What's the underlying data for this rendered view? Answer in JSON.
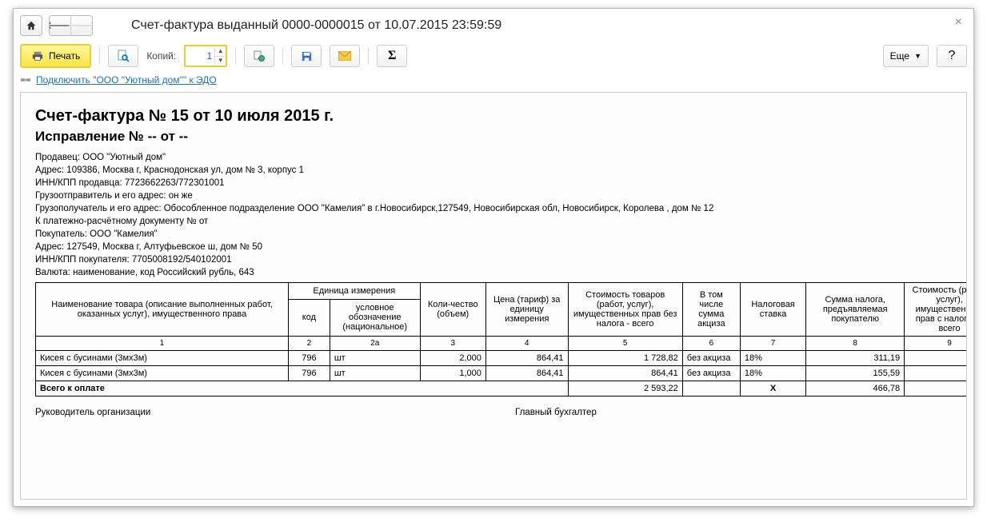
{
  "window": {
    "title": "Счет-фактура выданный 0000-0000015 от 10.07.2015 23:59:59"
  },
  "toolbar": {
    "print_label": "Печать",
    "copies_label": "Копий:",
    "copies_value": "1",
    "more_label": "Еще",
    "help_label": "?"
  },
  "edo_link": "Подключить \"ООО \"Уютный дом\"\" к ЭДО",
  "document": {
    "title": "Счет-фактура № 15 от 10 июля 2015 г.",
    "correction": "Исправление № -- от --",
    "seller": "Продавец: ООО \"Уютный дом\"",
    "seller_address": "Адрес: 109386, Москва г, Краснодонская ул, дом № 3, корпус 1",
    "seller_inn": "ИНН/КПП продавца: 7723662263/772301001",
    "shipper": "Грузоотправитель и его адрес: он же",
    "consignee": "Грузополучатель и его адрес: Обособленное подразделение ООО \"Камелия\" в г.Новосибирск,127549, Новосибирская обл, Новосибирск, Королева , дом № 12",
    "payment_doc": "К платежно-расчётному документу №     от",
    "buyer": "Покупатель: ООО \"Камелия\"",
    "buyer_address": "Адрес: 127549, Москва г, Алтуфьевское ш, дом № 50",
    "buyer_inn": "ИНН/КПП покупателя: 7705008192/540102001",
    "currency": "Валюта: наименование, код Российский рубль, 643",
    "total_label": "Всего к оплате",
    "sign_left": "Руководитель организации",
    "sign_right": "Главный бухгалтер"
  },
  "table": {
    "headers": {
      "name": "Наименование товара (описание выполненных работ, оказанных услуг), имущественного права",
      "unit_group": "Единица измерения",
      "unit_code": "код",
      "unit_name": "условное обозначение (национальное)",
      "qty": "Коли-чество (объем)",
      "price": "Цена (тариф) за единицу измерения",
      "cost_no_tax": "Стоимость товаров (работ, услуг), имущественных прав без налога - всего",
      "excise": "В том числе сумма акциза",
      "tax_rate": "Налоговая ставка",
      "tax_sum": "Сумма налога, предъявляемая покупателю",
      "cost_with_tax": "Стоимость (работ, услуг), имущественного прав с налогом - всего"
    },
    "colnums": [
      "1",
      "2",
      "2а",
      "3",
      "4",
      "5",
      "6",
      "7",
      "8",
      "9"
    ],
    "rows": [
      {
        "name": "Кисея с бусинами (3мх3м)",
        "code": "796",
        "unit": "шт",
        "qty": "2,000",
        "price": "864,41",
        "cost": "1 728,82",
        "excise": "без акциза",
        "rate": "18%",
        "tax": "311,19"
      },
      {
        "name": "Кисея с бусинами (3мх3м)",
        "code": "796",
        "unit": "шт",
        "qty": "1,000",
        "price": "864,41",
        "cost": "864,41",
        "excise": "без акциза",
        "rate": "18%",
        "tax": "155,59"
      }
    ],
    "totals": {
      "cost": "2 593,22",
      "rate_x": "X",
      "tax": "466,78"
    }
  }
}
